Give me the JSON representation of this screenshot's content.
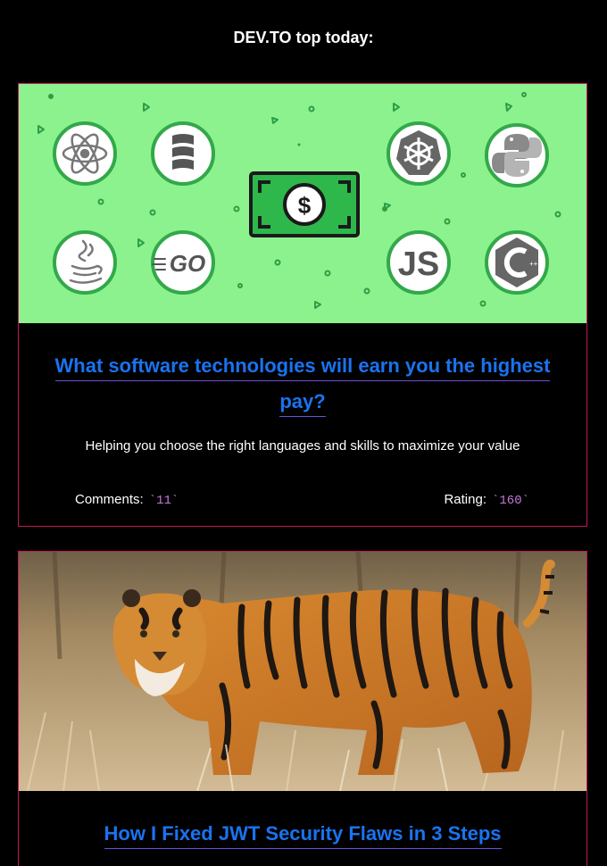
{
  "header": {
    "title": "DEV.TO top today:"
  },
  "articles": [
    {
      "title": "What software technologies will earn you the highest pay?",
      "description": "Helping you choose the right languages and skills to maximize your value",
      "comments_label": "Comments:",
      "comments_value": "`11`",
      "rating_label": "Rating:",
      "rating_value": "`160`",
      "banner_icons": [
        "react-icon",
        "scala-icon",
        "kubernetes-icon",
        "python-icon",
        "java-icon",
        "go-icon",
        "javascript-icon",
        "cplusplus-icon",
        "money-icon"
      ],
      "banner_text": {
        "go": "GO",
        "js": "JS",
        "dollar": "$"
      }
    },
    {
      "title": "How I Fixed JWT Security Flaws in 3 Steps"
    }
  ],
  "colors": {
    "background": "#000000",
    "card_border": "#c2185b",
    "title_link": "#1a73f0",
    "banner_green": "#8cf28e",
    "inline_code": "#c678dd"
  }
}
